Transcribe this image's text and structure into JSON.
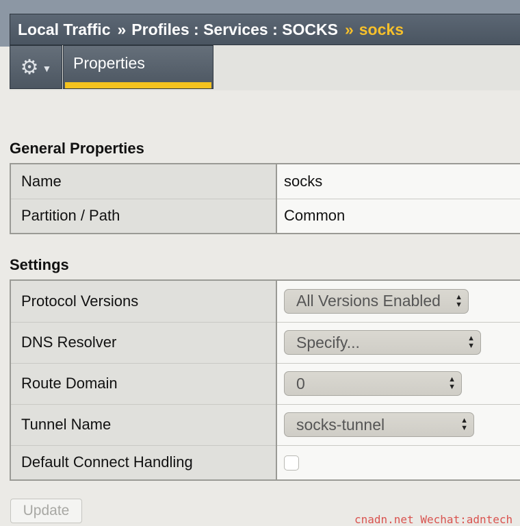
{
  "breadcrumb": {
    "part1": "Local Traffic",
    "sep1": "»",
    "part2": "Profiles : Services : SOCKS",
    "sep2": "»",
    "current": "socks"
  },
  "toolbar": {
    "gear_icon": "gear-icon",
    "caret_icon": "chevron-down-icon"
  },
  "tabs": [
    {
      "label": "Properties",
      "active": true
    }
  ],
  "general": {
    "title": "General Properties",
    "rows": [
      {
        "label": "Name",
        "value": "socks"
      },
      {
        "label": "Partition / Path",
        "value": "Common"
      }
    ]
  },
  "settings": {
    "title": "Settings",
    "protocol_versions": {
      "label": "Protocol Versions",
      "value": "All Versions Enabled"
    },
    "dns_resolver": {
      "label": "DNS Resolver",
      "value": "Specify..."
    },
    "route_domain": {
      "label": "Route Domain",
      "value": "0"
    },
    "tunnel_name": {
      "label": "Tunnel Name",
      "value": "socks-tunnel"
    },
    "default_connect": {
      "label": "Default Connect Handling",
      "checked": false
    }
  },
  "update_label": "Update",
  "watermark": "cnadn.net Wechat:adntech",
  "colors": {
    "header_bg": "#4f5a66",
    "accent": "#f4c21f",
    "page_bg": "#ebeae6"
  }
}
